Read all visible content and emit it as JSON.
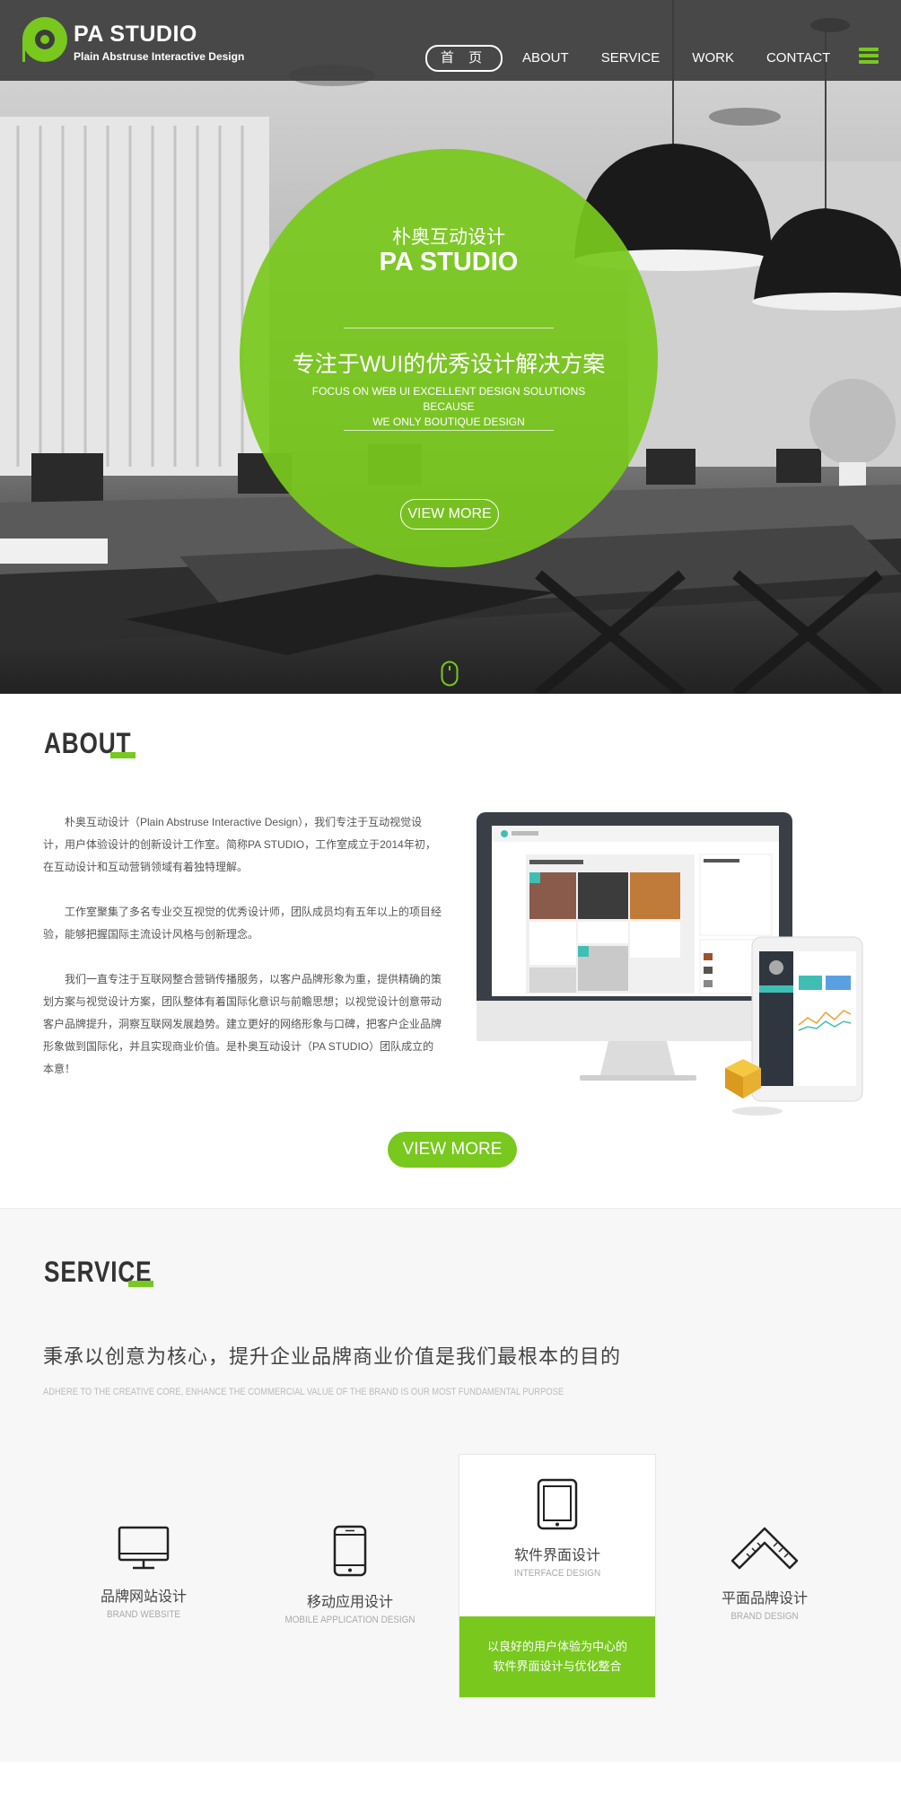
{
  "header": {
    "brand_name": "PA STUDIO",
    "brand_sub": "Plain Abstruse Interactive Design",
    "nav": [
      "首 页",
      "ABOUT",
      "SERVICE",
      "WORK",
      "CONTACT"
    ]
  },
  "hero": {
    "cn_title": "朴奥互动设计",
    "en_title": "PA STUDIO",
    "slogan": "专注于WUI的优秀设计解决方案",
    "desc_line1": "FOCUS ON WEB UI EXCELLENT DESIGN SOLUTIONS BECAUSE",
    "desc_line2": "WE ONLY BOUTIQUE DESIGN",
    "button": "VIEW MORE"
  },
  "about": {
    "title": "ABOUT",
    "paragraphs": [
      "朴奥互动设计（Plain Abstruse Interactive Design），我们专注于互动视觉设计，用户体验设计的创新设计工作室。简称PA STUDIO，工作室成立于2014年初，在互动设计和互动营销领域有着独特理解。",
      "工作室聚集了多名专业交互视觉的优秀设计师，团队成员均有五年以上的项目经验，能够把握国际主流设计风格与创新理念。",
      "我们一直专注于互联网整合营销传播服务，以客户品牌形象为重，提供精确的策划方案与视觉设计方案，团队整体有着国际化意识与前瞻思想；以视觉设计创意带动客户品牌提升，洞察互联网发展趋势。建立更好的网络形象与口碑，把客户企业品牌形象做到国际化，并且实现商业价值。是朴奥互动设计（PA STUDIO）团队成立的本意！"
    ],
    "button": "VIEW MORE"
  },
  "service": {
    "title": "SERVICE",
    "slogan": "秉承以创意为核心，提升企业品牌商业价值是我们最根本的目的",
    "sub": "ADHERE TO THE CREATIVE CORE, ENHANCE THE COMMERCIAL VALUE OF THE BRAND IS OUR MOST FUNDAMENTAL PURPOSE",
    "items": [
      {
        "cn": "品牌网站设计",
        "en": "BRAND WEBSITE"
      },
      {
        "cn": "移动应用设计",
        "en": "MOBILE APPLICATION DESIGN"
      },
      {
        "cn": "软件界面设计",
        "en": "INTERFACE DESIGN",
        "desc_line1": "以良好的用户体验为中心的",
        "desc_line2": "软件界面设计与优化整合"
      },
      {
        "cn": "平面品牌设计",
        "en": "BRAND DESIGN"
      }
    ]
  },
  "colors": {
    "accent": "#78c81e",
    "header_bg": "#3c3c3c",
    "service_bg": "#f7f7f7"
  }
}
